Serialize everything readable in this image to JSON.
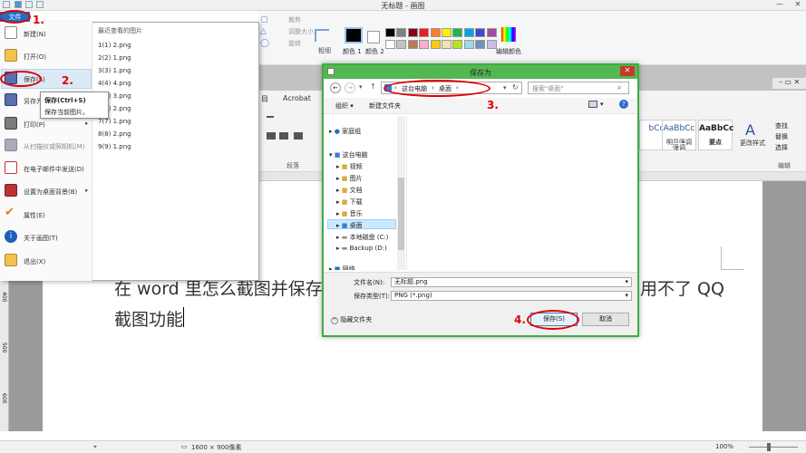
{
  "window": {
    "title": "无标题 - 画图",
    "minimize": "—",
    "close": "✕"
  },
  "paint_ribbon": {
    "crop": "裁剪",
    "resize": "调整大小",
    "rotate": "旋转",
    "size_label": "粗细",
    "color1": "颜色 1",
    "color2": "颜色 2",
    "edit_colors": "编辑颜色",
    "palette": [
      "#000000",
      "#7f7f7f",
      "#880015",
      "#ed1c24",
      "#ff7f27",
      "#fff200",
      "#22b14c",
      "#00a2e8",
      "#3f48cc",
      "#a349a4",
      "#ffffff",
      "#c3c3c3",
      "#b97a57",
      "#ffaec9",
      "#ffc90e",
      "#efe4b0",
      "#b5e61d",
      "#99d9ea",
      "#7092be",
      "#c8bfe7"
    ]
  },
  "word": {
    "tab_acrobat": "Acrobat",
    "tab_home_prefix": "目",
    "paragraph_label": "段落",
    "styles": [
      {
        "sample": "bCc",
        "name": ""
      },
      {
        "sample": "AaBbCc",
        "name": "明显强调"
      },
      {
        "sample": "AaBbCc",
        "name": "强调"
      },
      {
        "sample": "AaBbCc",
        "name": "要点"
      }
    ],
    "change_styles": "更改样式",
    "find": "查找",
    "replace": "替换",
    "select": "选择",
    "edit_group": "编辑",
    "doc_line1_left": "在 word 里怎么截图并保存图",
    "doc_line1_right": "用不了 QQ",
    "doc_line2": "截图功能",
    "left_ruler_marks": [
      "400",
      "500",
      "600"
    ]
  },
  "statusbar": {
    "dimensions": "1600 × 900像素",
    "zoom": "100%"
  },
  "file_menu": {
    "tab": "文件",
    "items": [
      {
        "label": "新建(N)",
        "icon": "new-doc-icon"
      },
      {
        "label": "打开(O)",
        "icon": "open-folder-icon"
      },
      {
        "label": "保存(S)",
        "icon": "save-icon"
      },
      {
        "label": "另存为(A)",
        "icon": "save-as-icon"
      },
      {
        "label": "打印(P)",
        "icon": "printer-icon"
      },
      {
        "label": "从扫描仪或照相机(M)",
        "icon": "scanner-icon"
      },
      {
        "label": "在电子邮件中发送(D)",
        "icon": "email-icon"
      },
      {
        "label": "设置为桌面背景(B)",
        "icon": "desktop-background-icon"
      },
      {
        "label": "属性(E)",
        "icon": "checkmark-icon"
      },
      {
        "label": "关于画图(T)",
        "icon": "info-icon"
      },
      {
        "label": "退出(X)",
        "icon": "exit-icon"
      }
    ],
    "recent_header": "最近查看的图片",
    "recent": [
      "1(1)  2.png",
      "2(2)  1.png",
      "3(3)  1.png",
      "4(4)  4.png",
      "5(5)  3.png",
      "6(6)  2.png",
      "7(7)  1.png",
      "8(8)  2.png",
      "9(9)  1.png"
    ],
    "tooltip_title": "保存(Ctrl+S)",
    "tooltip_desc": "保存当前图片。"
  },
  "dialog": {
    "title": "保存为",
    "breadcrumb_pc": "这台电脑",
    "breadcrumb_desktop": "桌面",
    "search_placeholder": "搜索\"桌面\"",
    "organize": "组织",
    "new_folder": "新建文件夹",
    "tree": [
      {
        "label": "家庭组",
        "indent": 0
      },
      {
        "label": "这台电脑",
        "indent": 0
      },
      {
        "label": "视频",
        "indent": 1
      },
      {
        "label": "图片",
        "indent": 1
      },
      {
        "label": "文档",
        "indent": 1
      },
      {
        "label": "下载",
        "indent": 1
      },
      {
        "label": "音乐",
        "indent": 1
      },
      {
        "label": "桌面",
        "indent": 1
      },
      {
        "label": "本地磁盘 (C:)",
        "indent": 1
      },
      {
        "label": "Backup (D:)",
        "indent": 1
      },
      {
        "label": "网络",
        "indent": 0
      }
    ],
    "filename_label": "文件名(N):",
    "filename_value": "无标题.png",
    "filetype_label": "保存类型(T):",
    "filetype_value": "PNG (*.png)",
    "hide_folders": "隐藏文件夹",
    "save_button": "保存(S)",
    "cancel_button": "取消"
  },
  "annotations": {
    "step1": "1.",
    "step2": "2.",
    "step3": "3.",
    "step4": "4.",
    "color": "#e00000"
  }
}
